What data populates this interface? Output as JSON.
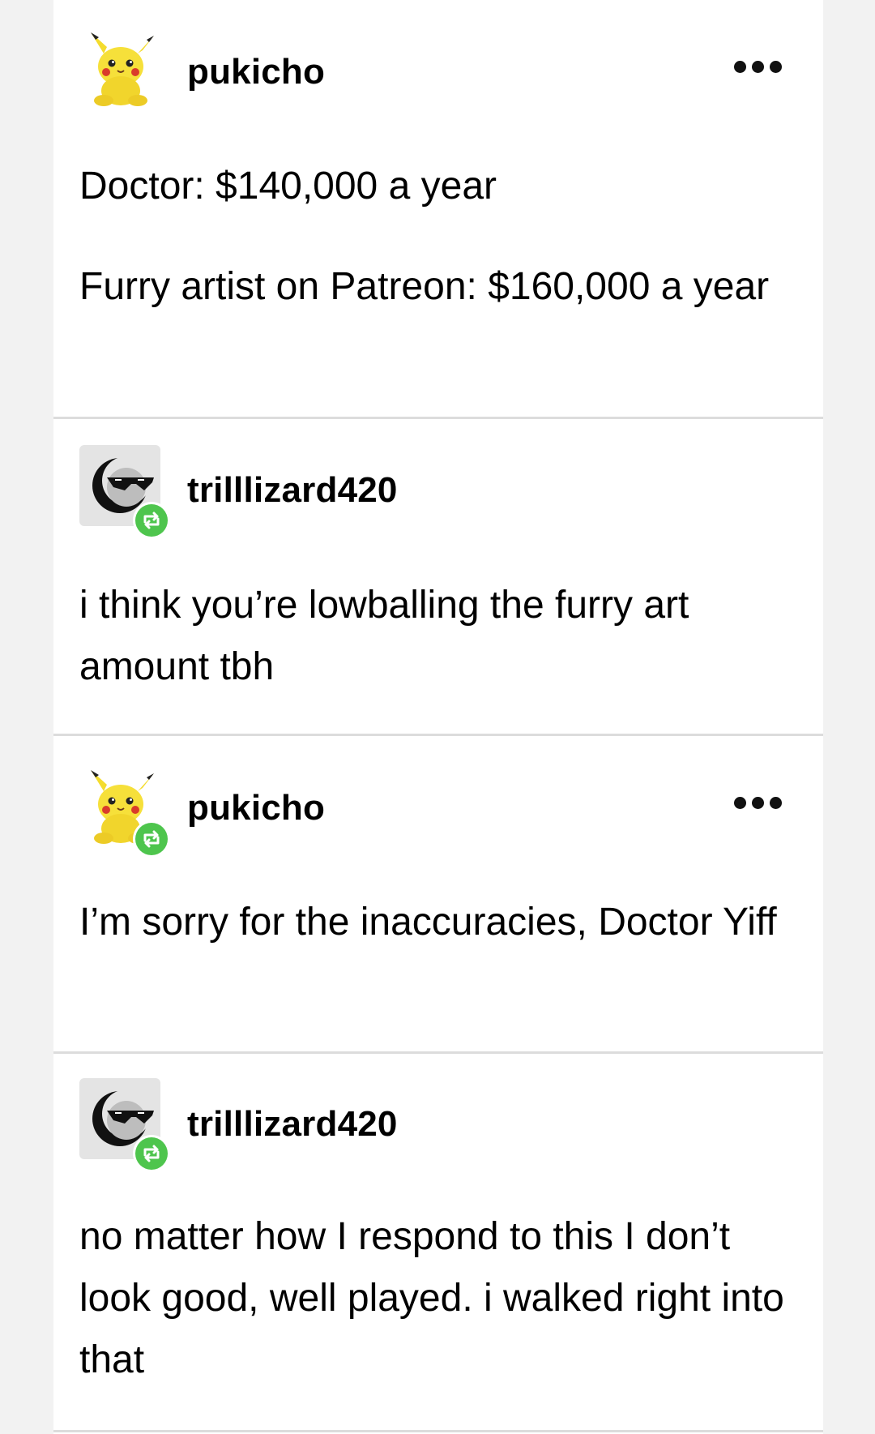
{
  "posts": [
    {
      "username": "pukicho",
      "avatar_icon": "pikachu-plush-avatar",
      "reblog": false,
      "has_more_menu": true,
      "paragraphs": [
        "Doctor: $140,000 a year",
        "Furry artist on Patreon: $160,000 a year"
      ]
    },
    {
      "username": "trilllizard420",
      "avatar_icon": "sunglasses-moon-avatar",
      "reblog": true,
      "has_more_menu": false,
      "paragraphs": [
        "i think you’re lowballing the furry art amount tbh"
      ]
    },
    {
      "username": "pukicho",
      "avatar_icon": "pikachu-plush-avatar",
      "reblog": true,
      "has_more_menu": true,
      "paragraphs": [
        "I’m sorry for the inaccuracies, Doctor Yiff"
      ]
    },
    {
      "username": "trilllizard420",
      "avatar_icon": "sunglasses-moon-avatar",
      "reblog": true,
      "has_more_menu": false,
      "paragraphs": [
        "no matter how I respond to this I don’t look good, well played. i walked right into that"
      ]
    }
  ],
  "colors": {
    "page_background": "#f2f2f2",
    "card_background": "#ffffff",
    "divider": "#dcdcdc",
    "reblog_badge": "#4ec54d",
    "text": "#000000"
  }
}
